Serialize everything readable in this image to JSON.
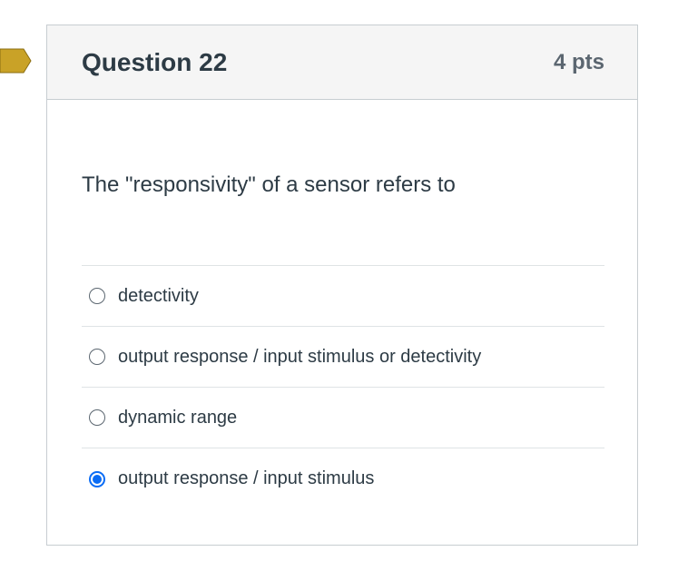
{
  "question": {
    "title": "Question 22",
    "points": "4 pts",
    "prompt": "The \"responsivity\" of a sensor refers to",
    "flag_color": "#c9a227"
  },
  "answers": [
    {
      "label": "detectivity",
      "selected": false
    },
    {
      "label": "output response / input stimulus or detectivity",
      "selected": false
    },
    {
      "label": "dynamic range",
      "selected": false
    },
    {
      "label": "output response / input stimulus",
      "selected": true
    }
  ],
  "colors": {
    "radio_selected": "#0a6cf5",
    "header_bg": "#f5f5f5",
    "border": "#c7cdd1"
  }
}
